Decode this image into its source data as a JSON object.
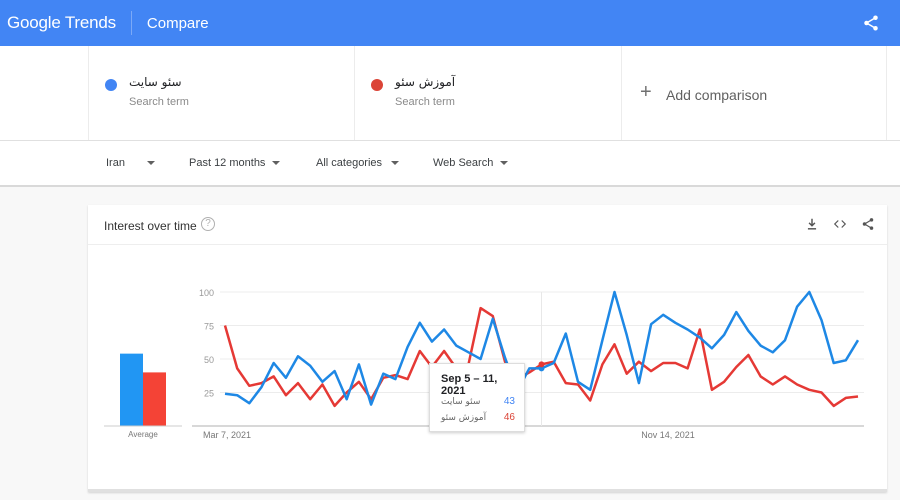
{
  "topbar": {
    "logo": "Google Trends",
    "title": "Compare",
    "share_icon": "share-icon",
    "color": "#4285f4"
  },
  "terms": [
    {
      "name": "سئو سایت",
      "sub": "Search term",
      "color": "#4285f4"
    },
    {
      "name": "آموزش سئو",
      "sub": "Search term",
      "color": "#db4437"
    }
  ],
  "add_comparison": {
    "icon": "+",
    "label": "Add comparison"
  },
  "filters": [
    {
      "label": "Iran"
    },
    {
      "label": "Past 12 months"
    },
    {
      "label": "All categories"
    },
    {
      "label": "Web Search"
    }
  ],
  "card": {
    "title": "Interest over time",
    "help_icon": "?",
    "actions": [
      "download-icon",
      "embed-icon",
      "share-icon"
    ]
  },
  "tooltip": {
    "date": "Sep 5 – 11, 2021",
    "rows": [
      {
        "term": "سئو سایت",
        "value": "43",
        "color": "#4285f4"
      },
      {
        "term": "آموزش سئو",
        "value": "46",
        "color": "#db4437"
      }
    ]
  },
  "chart_data": {
    "type": "line",
    "title": "Interest over time",
    "xlabel": "",
    "ylabel": "",
    "ylim": [
      0,
      100
    ],
    "yticks": [
      25,
      50,
      75,
      100
    ],
    "xtick_labels": [
      {
        "index": 0,
        "label": "Mar 7, 2021"
      },
      {
        "index": 36,
        "label": "Nov 14, 2021"
      }
    ],
    "grid": true,
    "hover_index": 26,
    "series": [
      {
        "name": "سئو سایت",
        "color": "#1e88e5",
        "average": 54,
        "values": [
          24,
          23,
          17,
          29,
          47,
          36,
          52,
          45,
          33,
          41,
          20,
          46,
          16,
          39,
          35,
          59,
          77,
          63,
          72,
          60,
          55,
          50,
          80,
          51,
          26,
          43,
          43,
          47,
          69,
          33,
          27,
          64,
          100,
          68,
          32,
          76,
          83,
          77,
          72,
          66,
          58,
          68,
          85,
          71,
          60,
          55,
          64,
          89,
          100,
          79,
          47,
          49,
          64
        ]
      },
      {
        "name": "آموزش سئو",
        "color": "#e53935",
        "average": 40,
        "values": [
          75,
          43,
          30,
          32,
          37,
          23,
          32,
          20,
          31,
          15,
          25,
          33,
          20,
          36,
          38,
          35,
          56,
          44,
          56,
          43,
          46,
          88,
          82,
          48,
          35,
          40,
          46,
          48,
          32,
          31,
          19,
          46,
          61,
          39,
          48,
          41,
          47,
          47,
          43,
          72,
          27,
          33,
          44,
          53,
          37,
          31,
          37,
          31,
          27,
          25,
          15,
          21,
          22
        ]
      }
    ],
    "average_label": "Average"
  }
}
